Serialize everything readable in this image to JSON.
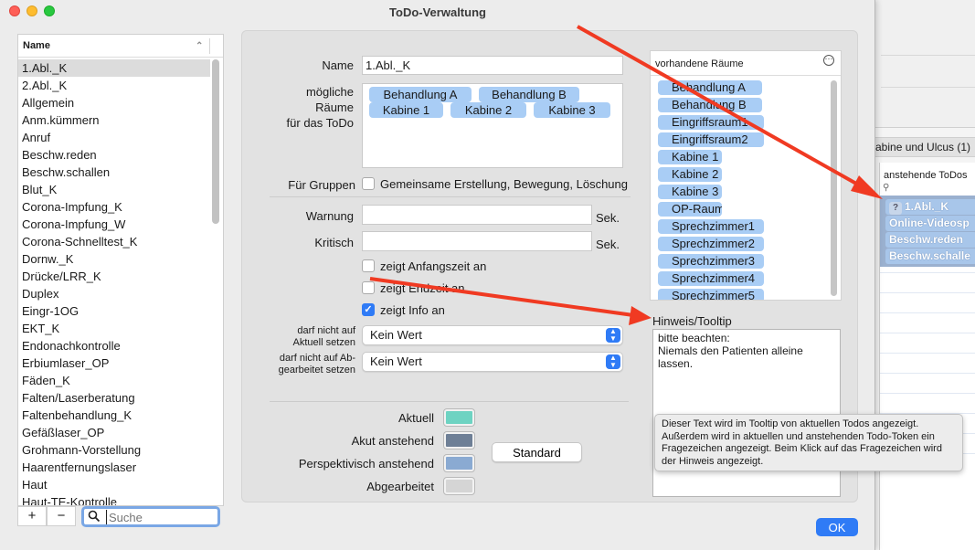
{
  "window": {
    "title": "ToDo-Verwaltung"
  },
  "list": {
    "header": "Name",
    "items": [
      "1.Abl._K",
      "2.Abl._K",
      "Allgemein",
      "Anm.kümmern",
      "Anruf",
      "Beschw.reden",
      "Beschw.schallen",
      "Blut_K",
      "Corona-Impfung_K",
      "Corona-Impfung_W",
      "Corona-Schnelltest_K",
      "Dornw._K",
      "Drücke/LRR_K",
      "Duplex",
      "Eingr-1OG",
      "EKT_K",
      "Endonachkontrolle",
      "Erbiumlaser_OP",
      "Fäden_K",
      "Falten/Laserberatung",
      "Faltenbehandlung_K",
      "Gefäßlaser_OP",
      "Grohmann-Vorstellung",
      "Haarentfernungslaser",
      "Haut",
      "Haut-TE-Kontrolle"
    ],
    "selected_index": 0,
    "add_label": "+",
    "remove_label": "−",
    "search_placeholder": "Suche"
  },
  "form": {
    "name_label": "Name",
    "name_value": "1.Abl._K",
    "rooms_label_1": "mögliche",
    "rooms_label_2": "Räume",
    "rooms_label_3": "für das ToDo",
    "selected_rooms": [
      "Behandlung A",
      "Behandlung B",
      "Kabine 1",
      "Kabine 2",
      "Kabine 3"
    ],
    "groups_label": "Für Gruppen",
    "groups_checkbox_label": "Gemeinsame Erstellung, Bewegung, Löschung",
    "groups_checked": false,
    "warning_label": "Warnung",
    "warning_value": "",
    "critical_label": "Kritisch",
    "critical_value": "",
    "unit_sek": "Sek.",
    "show_start_label": "zeigt Anfangszeit an",
    "show_start_checked": false,
    "show_end_label": "zeigt Endzeit an",
    "show_end_checked": false,
    "show_info_label": "zeigt Info an",
    "show_info_checked": true,
    "not_current_label_1": "darf nicht auf",
    "not_current_label_2": "Aktuell setzen",
    "not_current_value": "Kein Wert",
    "not_done_label_1": "darf nicht auf Ab-",
    "not_done_label_2": "gearbeitet setzen",
    "not_done_value": "Kein Wert",
    "colors": {
      "current_label": "Aktuell",
      "current_color": "#6ed3c2",
      "acute_label": "Akut anstehend",
      "acute_color": "#6e7f96",
      "perspective_label": "Perspektivisch anstehend",
      "perspective_color": "#8aaad2",
      "done_label": "Abgearbeitet",
      "done_color": "#d5d5d5"
    },
    "standard_button": "Standard"
  },
  "rooms": {
    "header": "vorhandene Räume",
    "items": [
      "Behandlung A",
      "Behandlung B",
      "Eingriffsraum1",
      "Eingriffsraum2",
      "Kabine 1",
      "Kabine 2",
      "Kabine 3",
      "OP-Raum",
      "Sprechzimmer1",
      "Sprechzimmer2",
      "Sprechzimmer3",
      "Sprechzimmer4",
      "Sprechzimmer5"
    ]
  },
  "hint": {
    "label": "Hinweis/Tooltip",
    "text": "bitte beachten:\nNiemals den Patienten alleine lassen."
  },
  "tooltip": {
    "text": "Dieser Text wird im Tooltip von aktuellen Todos angezeigt. Außerdem wird in aktuellen und anstehenden Todo-Token ein Fragezeichen angezeigt. Beim Klick auf das Fragezeichen wird der Hinweis angezeigt."
  },
  "ok_button": "OK",
  "background_app": {
    "tab_label": "abine und Ulcus (1)",
    "list_header": "anstehende ToDos",
    "tokens": [
      "1.Abl._K",
      "Online-Videosp",
      "Beschw.reden",
      "Beschw.schalle"
    ],
    "question_mark": "?"
  },
  "annotation_color": "#f03a22"
}
